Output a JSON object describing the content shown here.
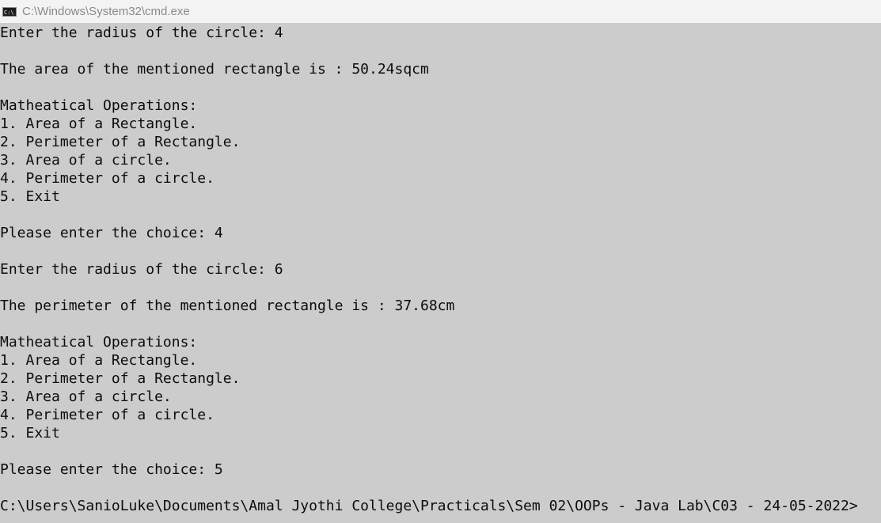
{
  "window": {
    "title": "C:\\Windows\\System32\\cmd.exe",
    "icon": "cmd-icon"
  },
  "console": {
    "lines": [
      "Enter the radius of the circle: 4",
      "",
      "The area of the mentioned rectangle is : 50.24sqcm",
      "",
      "Matheatical Operations:",
      "1. Area of a Rectangle.",
      "2. Perimeter of a Rectangle.",
      "3. Area of a circle.",
      "4. Perimeter of a circle.",
      "5. Exit",
      "",
      "Please enter the choice: 4",
      "",
      "Enter the radius of the circle: 6",
      "",
      "The perimeter of the mentioned rectangle is : 37.68cm",
      "",
      "Matheatical Operations:",
      "1. Area of a Rectangle.",
      "2. Perimeter of a Rectangle.",
      "3. Area of a circle.",
      "4. Perimeter of a circle.",
      "5. Exit",
      "",
      "Please enter the choice: 5",
      "",
      "C:\\Users\\SanioLuke\\Documents\\Amal Jyothi College\\Practicals\\Sem 02\\OOPs - Java Lab\\C03 - 24-05-2022>"
    ]
  }
}
